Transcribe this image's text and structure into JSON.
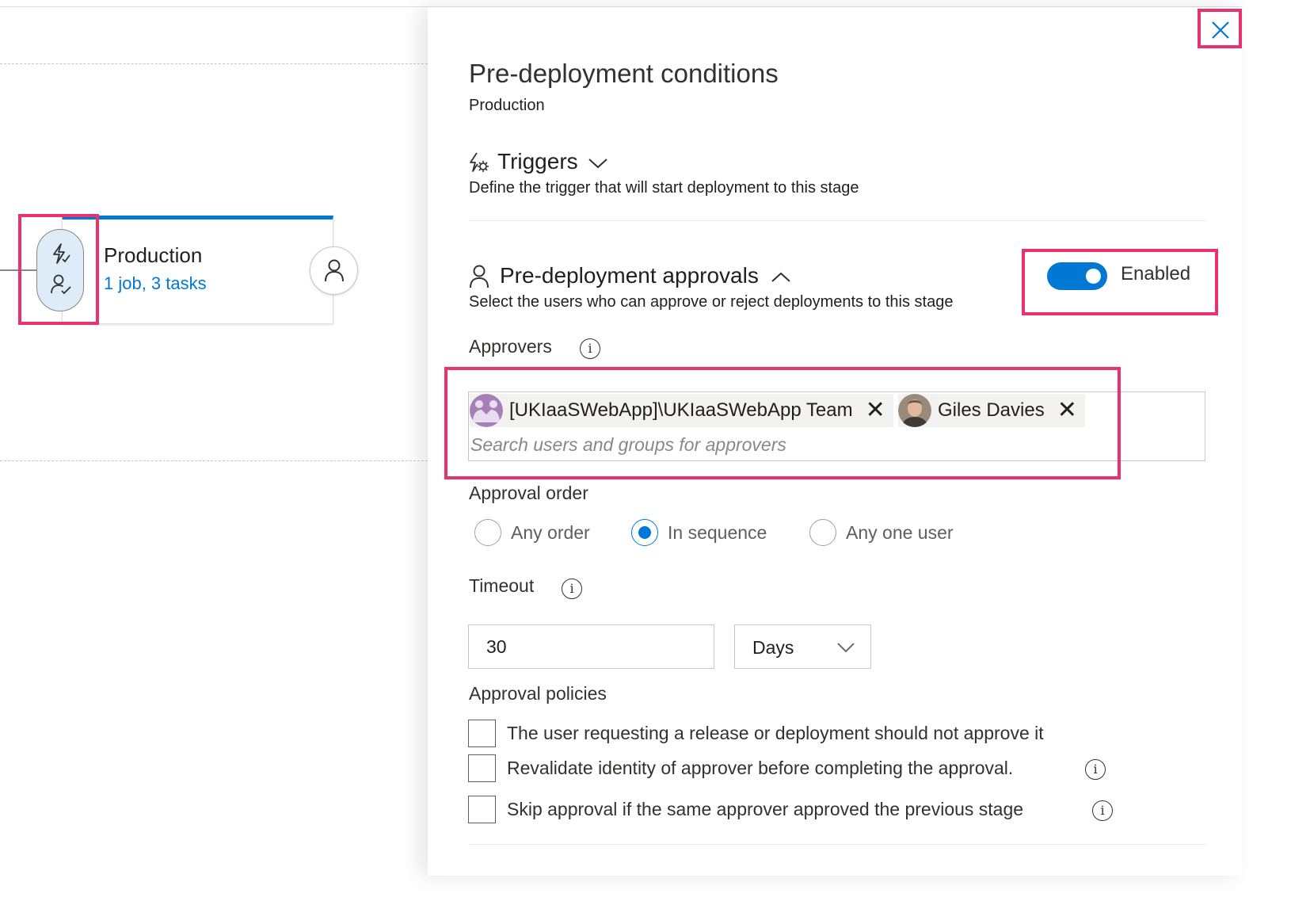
{
  "pipeline": {
    "stage": {
      "name": "Production",
      "summary": "1 job, 3 tasks"
    }
  },
  "panel": {
    "title": "Pre-deployment conditions",
    "subtitle": "Production",
    "close_icon": "close-icon"
  },
  "triggers": {
    "title": "Triggers",
    "description": "Define the trigger that will start deployment to this stage"
  },
  "approvals": {
    "title": "Pre-deployment approvals",
    "description": "Select the users who can approve or reject deployments to this stage",
    "toggle_label": "Enabled",
    "toggle_on": true,
    "approvers_label": "Approvers",
    "approvers": [
      {
        "name": "[UKIaaSWebApp]\\UKIaaSWebApp Team",
        "type": "group"
      },
      {
        "name": "Giles Davies",
        "type": "user"
      }
    ],
    "search_placeholder": "Search users and groups for approvers",
    "order_label": "Approval order",
    "order_options": [
      "Any order",
      "In sequence",
      "Any one user"
    ],
    "order_selected": "In sequence",
    "timeout_label": "Timeout",
    "timeout_value": "30",
    "timeout_unit": "Days",
    "policies_label": "Approval policies",
    "policies": [
      "The user requesting a release or deployment should not approve it",
      "Revalidate identity of approver before completing the approval.",
      "Skip approval if the same approver approved the previous stage"
    ]
  },
  "colors": {
    "accent": "#0078d4",
    "highlight": "#e8336e",
    "text": "#201f1e"
  }
}
